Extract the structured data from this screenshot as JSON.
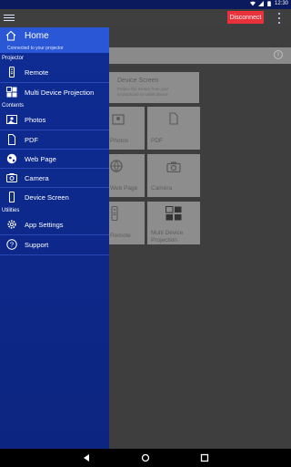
{
  "statusbar": {
    "time": "12:30"
  },
  "appbar": {
    "disconnect_label": "Disconnect"
  },
  "drawer": {
    "home_title": "Home",
    "home_subtitle": "Connected to your projector",
    "sections": {
      "projector": "Projector",
      "contents": "Contents",
      "utilities": "Utilities"
    },
    "items": {
      "remote": "Remote",
      "multi": "Multi Device Projection",
      "photos": "Photos",
      "pdf": "PDF",
      "web": "Web Page",
      "camera": "Camera",
      "device": "Device Screen",
      "settings": "App Settings",
      "support": "Support"
    }
  },
  "tiles": {
    "device_title": "Device Screen",
    "device_desc_1": "Project the screen from your",
    "device_desc_2": "smartphone or tablet device.",
    "photos": "Photos",
    "pdf": "PDF",
    "web": "Web Page",
    "camera": "Camera",
    "remote": "Remote",
    "multi_1": "Multi Device",
    "multi_2": "Projection"
  },
  "colors": {
    "drawer": "#0e2c94",
    "header": "#2a57d6",
    "disconnect": "#e8313a"
  }
}
